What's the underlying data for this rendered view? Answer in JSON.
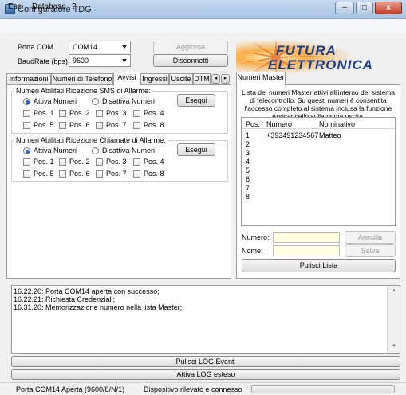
{
  "window": {
    "title": "Configuratore TDG",
    "minimize": "–",
    "maximize": "□",
    "close": "x"
  },
  "menu": {
    "items": [
      "Esci",
      "Database",
      "?"
    ]
  },
  "connection": {
    "port_label": "Porta COM",
    "port_value": "COM14",
    "baud_label": "BaudRate (bps)",
    "baud_value": "9600",
    "update_button": "Aggiorna",
    "disconnect_button": "Disconnetti"
  },
  "logo": {
    "line1": "FUTURA",
    "line2": "ELETTRONICA"
  },
  "tabs": [
    "Informazioni",
    "Numeri di Telefono",
    "Avvisi",
    "Ingressi",
    "Uscite",
    "DTM"
  ],
  "active_tab": "Avvisi",
  "sms_group": {
    "title": "Numeri Abilitati Ricezione SMS di Allarme:",
    "enable": "Attiva Numeri",
    "disable": "Disattiva Numeri",
    "execute": "Esegui",
    "positions": [
      "Pos. 1",
      "Pos. 2",
      "Pos. 3",
      "Pos. 4",
      "Pos. 5",
      "Pos. 6",
      "Pos. 7",
      "Pos. 8"
    ]
  },
  "call_group": {
    "title": "Numeri Abilitati Ricezione Chiamate di Allarme:",
    "enable": "Attiva Numeri",
    "disable": "Disattiva Numeri",
    "execute": "Esegui",
    "positions": [
      "Pos. 1",
      "Pos. 2",
      "Pos. 3",
      "Pos. 4",
      "Pos. 5",
      "Pos. 6",
      "Pos. 7",
      "Pos. 8"
    ]
  },
  "master": {
    "tab": "Numeri Master",
    "description": "Lista dei numeri Master attivi all'interno del sistema di telecontrollo. Su questi numeri è consentita l'accesso completo al sistema inclusa la funzione Apricancello sulla prima uscita.",
    "columns": [
      "Pos.",
      "Numero",
      "Nominativo"
    ],
    "rows": [
      {
        "pos": "1",
        "numero": "+393491234567",
        "nome": "Matteo"
      },
      {
        "pos": "2",
        "numero": "",
        "nome": ""
      },
      {
        "pos": "3",
        "numero": "",
        "nome": ""
      },
      {
        "pos": "4",
        "numero": "",
        "nome": ""
      },
      {
        "pos": "5",
        "numero": "",
        "nome": ""
      },
      {
        "pos": "6",
        "numero": "",
        "nome": ""
      },
      {
        "pos": "7",
        "numero": "",
        "nome": ""
      },
      {
        "pos": "8",
        "numero": "",
        "nome": ""
      }
    ],
    "numero_label": "Numero:",
    "nome_label": "Nome:",
    "cancel_button": "Annulla",
    "save_button": "Salva",
    "clear_button": "Pulisci Lista"
  },
  "log": {
    "lines": [
      "16.22.20: Porta COM14 aperta con successo;",
      "16.22.21: Richiesta Credenziali;",
      "16.31.20: Memorizzazione numero nella lista Master;"
    ],
    "clear_button": "Pulisci LOG Eventi",
    "extended_button": "Attiva LOG esteso"
  },
  "status": {
    "port": "Porta COM14 Aperta (9600/8/N/1)",
    "device": "Dispositivo rilevato e connesso"
  }
}
